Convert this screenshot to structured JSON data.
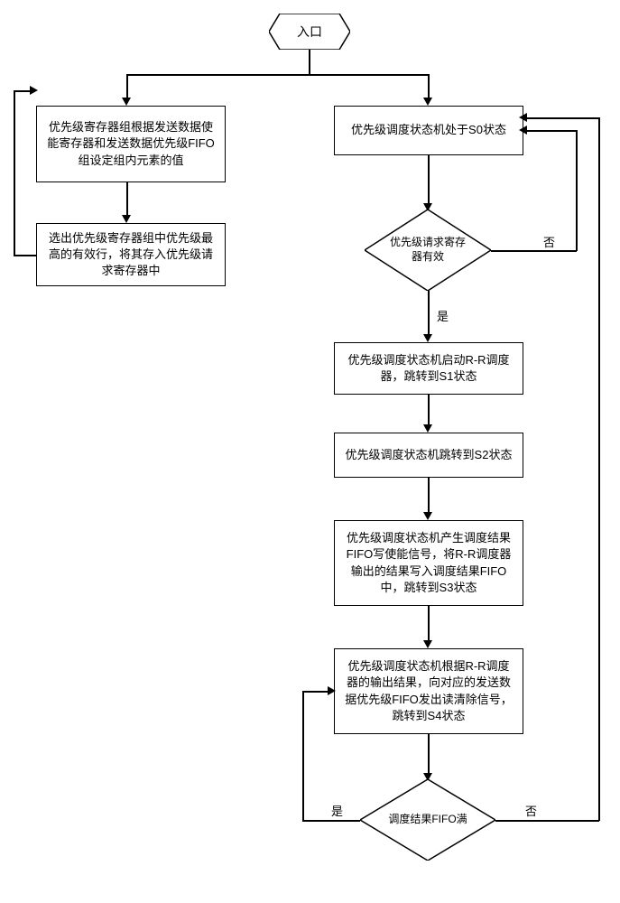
{
  "chart_data": {
    "type": "flowchart",
    "nodes": [
      {
        "id": "entry",
        "shape": "hexagon",
        "label": "入口"
      },
      {
        "id": "left1",
        "shape": "rect",
        "label": "优先级寄存器组根据\n发送数据使能寄存器和\n发送数据优先级FIFO组设定组\n内元素的值"
      },
      {
        "id": "left2",
        "shape": "rect",
        "label": "选出优先级寄存器组中优先级\n最高的有效行，将其存入优先\n级请求寄存器中"
      },
      {
        "id": "s0",
        "shape": "rect",
        "label": "优先级调度状态机处于S0状态"
      },
      {
        "id": "d1",
        "shape": "diamond",
        "label": "优先级请求寄\n存器有效"
      },
      {
        "id": "s1",
        "shape": "rect",
        "label": "优先级调度状态机启动R-\nR调度器，跳转到S1状态"
      },
      {
        "id": "s2",
        "shape": "rect",
        "label": "优先级调度状态机跳\n转到S2状态"
      },
      {
        "id": "s3",
        "shape": "rect",
        "label": "优先级调度状态机产生调度结\n果FIFO写使能信号，将R-\nR调度器输出的结果写入调度\n结果FIFO中，跳转到S3状态"
      },
      {
        "id": "s4",
        "shape": "rect",
        "label": "优先级调度状态机根据R-\nR调度器的输出结果，向对应\n的发送数据优先级FIFO发出读\n清除信号，跳转到S4状态"
      },
      {
        "id": "d2",
        "shape": "diamond",
        "label": "调度结果FIFO\n满"
      }
    ],
    "edges": [
      {
        "from": "entry",
        "to": "left1"
      },
      {
        "from": "entry",
        "to": "s0"
      },
      {
        "from": "left1",
        "to": "left2"
      },
      {
        "from": "left2",
        "to": "left1",
        "note": "loop back (via top)"
      },
      {
        "from": "s0",
        "to": "d1"
      },
      {
        "from": "d1",
        "to": "s1",
        "label": "是"
      },
      {
        "from": "d1",
        "to": "s0",
        "label": "否",
        "note": "loop back right"
      },
      {
        "from": "s1",
        "to": "s2"
      },
      {
        "from": "s2",
        "to": "s3"
      },
      {
        "from": "s3",
        "to": "s4"
      },
      {
        "from": "s4",
        "to": "d2"
      },
      {
        "from": "d2",
        "to": "s4",
        "label": "是",
        "note": "loop left, stay"
      },
      {
        "from": "d2",
        "to": "s0",
        "label": "否",
        "note": "loop right up"
      }
    ],
    "labels": {
      "yes": "是",
      "no": "否"
    }
  },
  "entry": {
    "label": "入口"
  },
  "left1": {
    "text": "优先级寄存器组根据发送数据使能寄存器和发送数据优先级FIFO组设定组内元素的值"
  },
  "left2": {
    "text": "选出优先级寄存器组中优先级最高的有效行，将其存入优先级请求寄存器中"
  },
  "s0": {
    "text": "优先级调度状态机处于S0状态"
  },
  "d1": {
    "text": "优先级请求寄存器有效"
  },
  "s1": {
    "text": "优先级调度状态机启动R-R调度器，跳转到S1状态"
  },
  "s2": {
    "text": "优先级调度状态机跳转到S2状态"
  },
  "s3": {
    "text": "优先级调度状态机产生调度结果FIFO写使能信号，将R-R调度器输出的结果写入调度结果FIFO中，跳转到S3状态"
  },
  "s4": {
    "text": "优先级调度状态机根据R-R调度器的输出结果，向对应的发送数据优先级FIFO发出读清除信号，跳转到S4状态"
  },
  "d2": {
    "text": "调度结果FIFO满"
  },
  "labels": {
    "yes": "是",
    "no": "否"
  }
}
